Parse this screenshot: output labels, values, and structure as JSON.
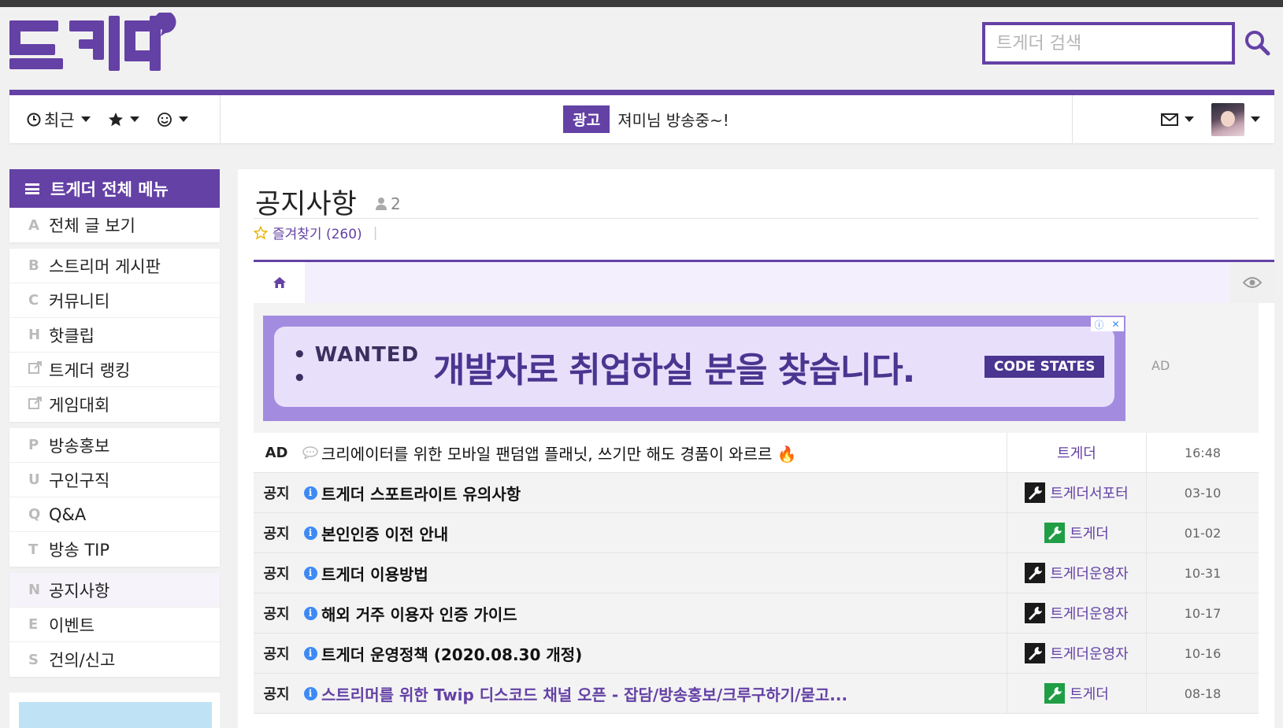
{
  "header": {
    "logo_text": "트게더",
    "search_placeholder": "트게더 검색"
  },
  "navbar": {
    "recent_label": "최근",
    "ad_badge": "광고",
    "live_text": "져미님 방송중~!"
  },
  "sidebar": {
    "menu_title": "트게더 전체 메뉴",
    "groups": [
      [
        {
          "letter": "A",
          "label": "전체 글 보기"
        }
      ],
      [
        {
          "letter": "B",
          "label": "스트리머 게시판"
        },
        {
          "letter": "C",
          "label": "커뮤니티"
        },
        {
          "letter": "H",
          "label": "핫클립"
        },
        {
          "letter": "",
          "label": "트게더 랭킹"
        },
        {
          "letter": "",
          "label": "게임대회"
        }
      ],
      [
        {
          "letter": "P",
          "label": "방송홍보"
        },
        {
          "letter": "U",
          "label": "구인구직"
        },
        {
          "letter": "Q",
          "label": "Q&A"
        },
        {
          "letter": "T",
          "label": "방송 TIP"
        }
      ],
      [
        {
          "letter": "N",
          "label": "공지사항"
        },
        {
          "letter": "E",
          "label": "이벤트"
        },
        {
          "letter": "S",
          "label": "건의/신고"
        }
      ]
    ]
  },
  "board": {
    "title": "공지사항",
    "member_count": "2",
    "favorite_label": "즐겨찾기 (260)"
  },
  "ad_banner": {
    "wanted": "• WANTED •",
    "headline": "개발자로 취업하실 분을 찾습니다.",
    "sponsor": "CODE STATES",
    "side_label": "AD"
  },
  "posts": [
    {
      "type": "AD",
      "title": "크리에이터를 위한 모바일 팬덤앱 플래닛, 쓰기만 해도 경품이 와르르 🔥",
      "author": "트게더",
      "badge": "none",
      "time": "16:48",
      "style": "ad"
    },
    {
      "type": "공지",
      "title": "트게더 스포트라이트 유의사항",
      "author": "트게더서포터",
      "badge": "dark",
      "time": "03-10",
      "style": "bold"
    },
    {
      "type": "공지",
      "title": "본인인증 이전 안내",
      "author": "트게더",
      "badge": "green",
      "time": "01-02",
      "style": "bold"
    },
    {
      "type": "공지",
      "title": "트게더 이용방법",
      "author": "트게더운영자",
      "badge": "dark",
      "time": "10-31",
      "style": "bold"
    },
    {
      "type": "공지",
      "title": "해외 거주 이용자 인증 가이드",
      "author": "트게더운영자",
      "badge": "dark",
      "time": "10-17",
      "style": "bold"
    },
    {
      "type": "공지",
      "title": "트게더 운영정책 (2020.08.30 개정)",
      "author": "트게더운영자",
      "badge": "dark",
      "time": "10-16",
      "style": "bold"
    },
    {
      "type": "공지",
      "title": "스트리머를 위한 Twip 디스코드 채널 오픈 - 잡담/방송홍보/크루구하기/묻고...",
      "author": "트게더",
      "badge": "green",
      "time": "08-18",
      "style": "purple"
    }
  ],
  "colors": {
    "brand": "#6441a5",
    "info_blue": "#3d8af7"
  }
}
